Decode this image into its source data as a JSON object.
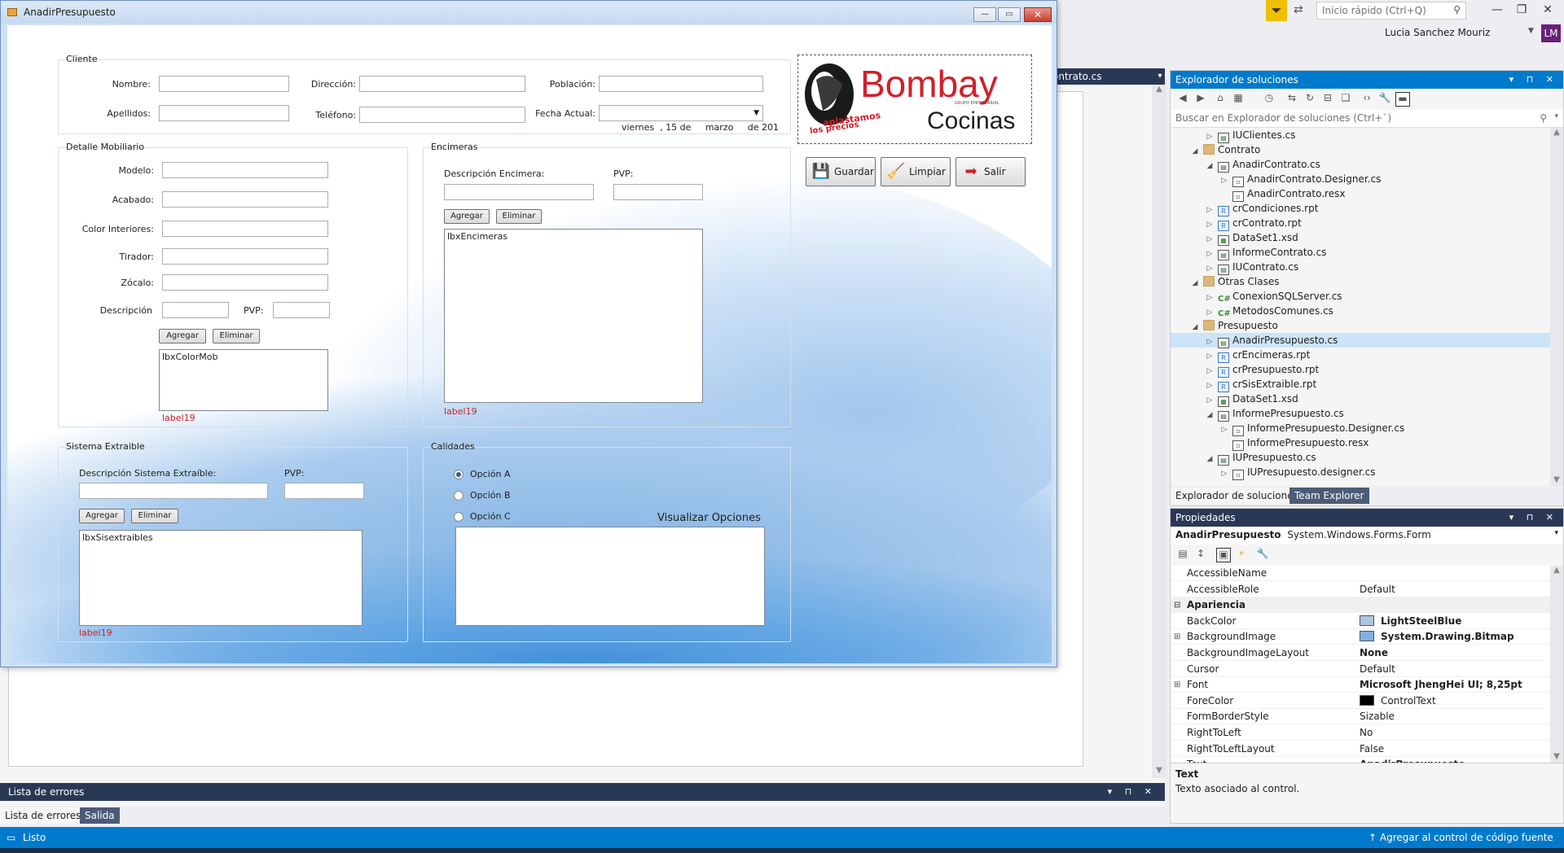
{
  "ide": {
    "quick_launch_placeholder": "Inicio rápido (Ctrl+Q)",
    "user_name": "Lucia Sanchez Mouriz",
    "user_initials": "LM",
    "doc_tab": "ontrato.cs"
  },
  "form": {
    "title": "AnadirPresupuesto",
    "cliente": {
      "legend": "Cliente",
      "nombre_label": "Nombre:",
      "apellidos_label": "Apellidos:",
      "direccion_label": "Dirección:",
      "telefono_label": "Teléfono:",
      "poblacion_label": "Población:",
      "fecha_label": "Fecha Actual:",
      "fecha_value": "viernes  , 15 de     marzo     de 201"
    },
    "logo": {
      "brand": "Bombay",
      "sub": "Cocinas",
      "tag": "GRUPO EMPRESARIAL",
      "slogan": "los precios",
      "slogan2": "aplastamos"
    },
    "actions": {
      "guardar": "Guardar",
      "limpiar": "Limpiar",
      "salir": "Salir"
    },
    "mobiliario": {
      "legend": "Detalle Mobiliario",
      "modelo": "Modelo:",
      "acabado": "Acabado:",
      "color_interiores": "Color Interiores:",
      "tirador": "Tirador:",
      "zocalo": "Zócalo:",
      "descripcion": "Descripción",
      "pvp": "PVP:",
      "agregar": "Agregar",
      "eliminar": "Eliminar",
      "listbox": "lbxColorMob",
      "status": "label19"
    },
    "encimeras": {
      "legend": "Encimeras",
      "descripcion": "Descripción Encimera:",
      "pvp": "PVP:",
      "agregar": "Agregar",
      "eliminar": "Eliminar",
      "listbox": "lbxEncimeras",
      "status": "label19"
    },
    "sistema": {
      "legend": "Sistema Extraible",
      "descripcion": "Descripción Sistema Extraíble:",
      "pvp": "PVP:",
      "agregar": "Agregar",
      "eliminar": "Eliminar",
      "listbox": "lbxSisextraibles",
      "status": "label19"
    },
    "calidades": {
      "legend": "Calidades",
      "opcion_a": "Opción A",
      "opcion_b": "Opción B",
      "opcion_c": "Opción C",
      "selected": "Opción A",
      "visualizar": "Visualizar Opciones"
    }
  },
  "solution_explorer": {
    "title": "Explorador de soluciones",
    "search_placeholder": "Buscar en Explorador de soluciones (Ctrl+`)",
    "items": [
      {
        "label": "IUClientes.cs",
        "depth": 2,
        "arrow": "▷",
        "icon": "form"
      },
      {
        "label": "Contrato",
        "depth": 1,
        "arrow": "◢",
        "icon": "folder"
      },
      {
        "label": "AnadirContrato.cs",
        "depth": 2,
        "arrow": "◢",
        "icon": "form"
      },
      {
        "label": "AnadirContrato.Designer.cs",
        "depth": 3,
        "arrow": "▷",
        "icon": "cs-file"
      },
      {
        "label": "AnadirContrato.resx",
        "depth": 3,
        "arrow": "",
        "icon": "resx"
      },
      {
        "label": "crCondiciones.rpt",
        "depth": 2,
        "arrow": "▷",
        "icon": "rpt"
      },
      {
        "label": "crContrato.rpt",
        "depth": 2,
        "arrow": "▷",
        "icon": "rpt"
      },
      {
        "label": "DataSet1.xsd",
        "depth": 2,
        "arrow": "▷",
        "icon": "dataset"
      },
      {
        "label": "InformeContrato.cs",
        "depth": 2,
        "arrow": "▷",
        "icon": "form"
      },
      {
        "label": "IUContrato.cs",
        "depth": 2,
        "arrow": "▷",
        "icon": "form"
      },
      {
        "label": "Otras Clases",
        "depth": 1,
        "arrow": "◢",
        "icon": "folder"
      },
      {
        "label": "ConexionSQLServer.cs",
        "depth": 2,
        "arrow": "▷",
        "icon": "csharp"
      },
      {
        "label": "MetodosComunes.cs",
        "depth": 2,
        "arrow": "▷",
        "icon": "csharp"
      },
      {
        "label": "Presupuesto",
        "depth": 1,
        "arrow": "◢",
        "icon": "folder"
      },
      {
        "label": "AnadirPresupuesto.cs",
        "depth": 2,
        "arrow": "▷",
        "icon": "form",
        "selected": true
      },
      {
        "label": "crEncimeras.rpt",
        "depth": 2,
        "arrow": "▷",
        "icon": "rpt"
      },
      {
        "label": "crPresupuesto.rpt",
        "depth": 2,
        "arrow": "▷",
        "icon": "rpt"
      },
      {
        "label": "crSisExtraible.rpt",
        "depth": 2,
        "arrow": "▷",
        "icon": "rpt"
      },
      {
        "label": "DataSet1.xsd",
        "depth": 2,
        "arrow": "▷",
        "icon": "dataset"
      },
      {
        "label": "InformePresupuesto.cs",
        "depth": 2,
        "arrow": "◢",
        "icon": "form"
      },
      {
        "label": "InformePresupuesto.Designer.cs",
        "depth": 3,
        "arrow": "▷",
        "icon": "cs-file"
      },
      {
        "label": "InformePresupuesto.resx",
        "depth": 3,
        "arrow": "",
        "icon": "resx"
      },
      {
        "label": "IUPresupuesto.cs",
        "depth": 2,
        "arrow": "◢",
        "icon": "form"
      },
      {
        "label": "IUPresupuesto.designer.cs",
        "depth": 3,
        "arrow": "▷",
        "icon": "cs-file"
      }
    ],
    "tab_active": "Explorador de soluciones",
    "tab_other": "Team Explorer"
  },
  "properties": {
    "title": "Propiedades",
    "object_name": "AnadirPresupuesto",
    "object_type": "System.Windows.Forms.Form",
    "rows": [
      {
        "name": "AccessibleName",
        "value": ""
      },
      {
        "name": "AccessibleRole",
        "value": "Default"
      },
      {
        "name": "Apariencia",
        "value": "",
        "category": true
      },
      {
        "name": "BackColor",
        "value": "LightSteelBlue",
        "swatch": "#b0c4de",
        "bold": true
      },
      {
        "name": "BackgroundImage",
        "value": "System.Drawing.Bitmap",
        "swatch": "#7fb2e3",
        "bold": true,
        "expand": true
      },
      {
        "name": "BackgroundImageLayout",
        "value": "None",
        "bold": true
      },
      {
        "name": "Cursor",
        "value": "Default"
      },
      {
        "name": "Font",
        "value": "Microsoft JhengHei UI; 8,25pt",
        "bold": true,
        "expand": true
      },
      {
        "name": "ForeColor",
        "value": "ControlText",
        "swatch": "#000000"
      },
      {
        "name": "FormBorderStyle",
        "value": "Sizable"
      },
      {
        "name": "RightToLeft",
        "value": "No"
      },
      {
        "name": "RightToLeftLayout",
        "value": "False"
      },
      {
        "name": "Text",
        "value": "AnadirPresupuesto",
        "bold": true
      }
    ],
    "desc_title": "Text",
    "desc_text": "Texto asociado al control."
  },
  "error_list": {
    "title": "Lista de errores",
    "tab_active": "Lista de errores",
    "tab_other": "Salida"
  },
  "status_bar": {
    "text": "Listo",
    "right": "Agregar al control de código fuente"
  },
  "colors": {
    "ide_accent": "#007acc",
    "panel_title": "#293955",
    "form_back": "LightSteelBlue",
    "error_label": "#d1202a"
  }
}
